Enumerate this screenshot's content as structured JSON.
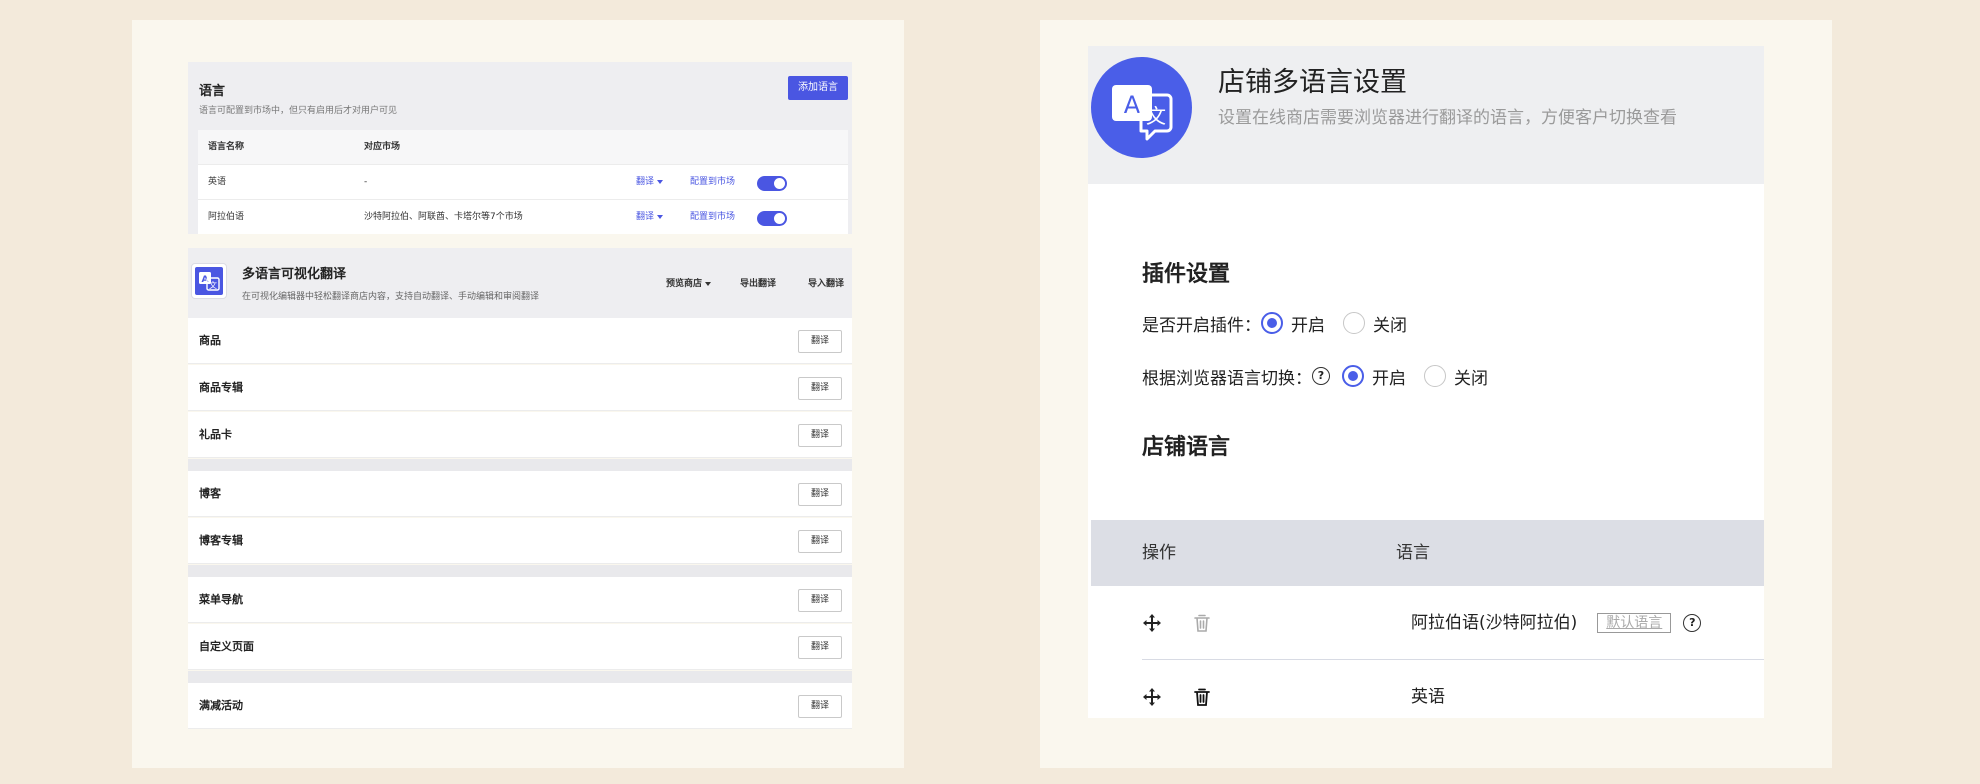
{
  "left": {
    "language_card": {
      "title": "语言",
      "subtitle": "语言可配置到市场中，但只有启用后才对用户可见",
      "add_button": "添加语言",
      "columns": [
        "语言名称",
        "对应市场"
      ],
      "rows": [
        {
          "name": "英语",
          "market": "-",
          "translate": "翻译",
          "config": "配置到市场",
          "enabled": true
        },
        {
          "name": "阿拉伯语",
          "market": "沙特阿拉伯、阿联酋、卡塔尔等7个市场",
          "translate": "翻译",
          "config": "配置到市场",
          "enabled": true
        }
      ]
    },
    "translate_card": {
      "title": "多语言可视化翻译",
      "subtitle": "在可视化编辑器中轻松翻译商店内容，支持自动翻译、手动编辑和审阅翻译",
      "actions": {
        "preview": "预览商店",
        "export": "导出翻译",
        "import": "导入翻译"
      },
      "button_label": "翻译",
      "groups": [
        [
          "商品",
          "商品专辑",
          "礼品卡"
        ],
        [
          "博客",
          "博客专辑"
        ],
        [
          "菜单导航",
          "自定义页面"
        ],
        [
          "满减活动"
        ]
      ]
    }
  },
  "right": {
    "title": "店铺多语言设置",
    "subtitle": "设置在线商店需要浏览器进行翻译的语言，方便客户切换查看",
    "plugin_section": "插件设置",
    "plugin_enable_label": "是否开启插件：",
    "browser_switch_label": "根据浏览器语言切换：",
    "on": "开启",
    "off": "关闭",
    "help_glyph": "?",
    "store_lang_section": "店铺语言",
    "table_headers": {
      "action": "操作",
      "language": "语言"
    },
    "rows": [
      {
        "language": "阿拉伯语(沙特阿拉伯)",
        "badge": "默认语言",
        "has_help": true,
        "trash_disabled": true
      },
      {
        "language": "英语",
        "badge": "",
        "has_help": false,
        "trash_disabled": false
      }
    ]
  },
  "colors": {
    "accent": "#4a56e2",
    "background": "#f3eadb",
    "panel": "#faf7ee"
  }
}
